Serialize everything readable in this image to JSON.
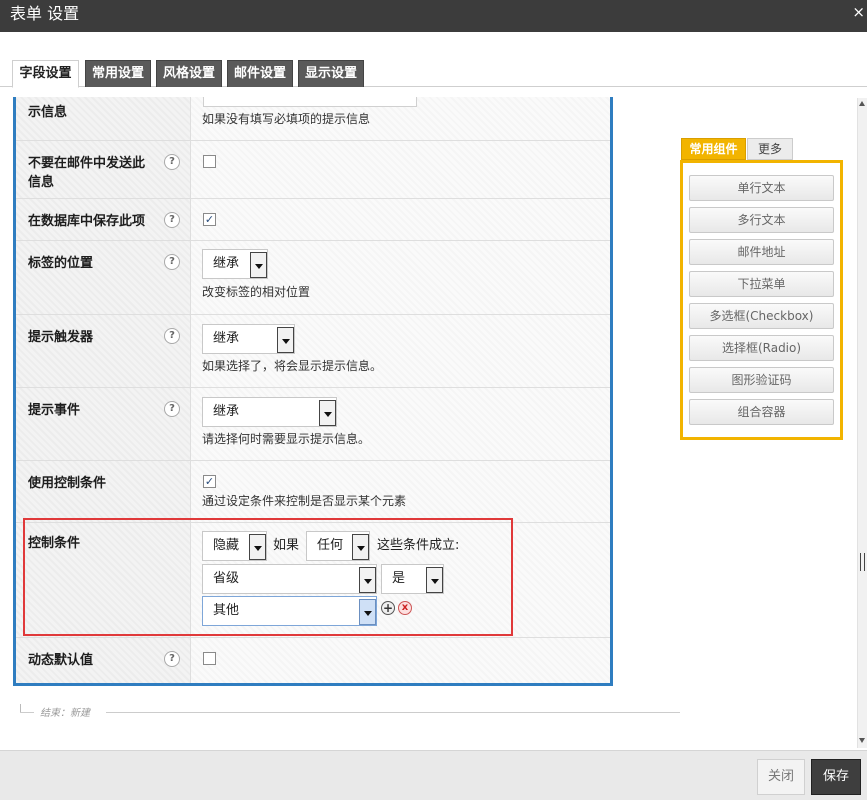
{
  "window": {
    "title": "表单 设置",
    "close_glyph": "×"
  },
  "tabs": [
    {
      "label": "字段设置"
    },
    {
      "label": "常用设置"
    },
    {
      "label": "风格设置"
    },
    {
      "label": "邮件设置"
    },
    {
      "label": "显示设置"
    }
  ],
  "fields": {
    "required_message": {
      "label_visible": "示信息",
      "description": "如果没有填写必填项的提示信息"
    },
    "no_email": {
      "label": "不要在邮件中发送此信息",
      "help": "?",
      "checked": false
    },
    "save_db": {
      "label": "在数据库中保存此项",
      "help": "?",
      "checked": true,
      "check_glyph": "✓"
    },
    "label_position": {
      "label": "标签的位置",
      "help": "?",
      "select_value": "继承",
      "description": "改变标签的相对位置"
    },
    "tooltip_trigger": {
      "label": "提示触发器",
      "help": "?",
      "select_value": "继承",
      "description": "如果选择了，将会显示提示信息。"
    },
    "tooltip_event": {
      "label": "提示事件",
      "help": "?",
      "select_value": "继承",
      "description": "请选择何时需要显示提示信息。"
    },
    "use_conditions": {
      "label": "使用控制条件",
      "checked": true,
      "check_glyph": "✓",
      "description": "通过设定条件来控制是否显示某个元素"
    },
    "conditions": {
      "label": "控制条件",
      "action": "隐藏",
      "if_text": "如果",
      "match": "任何",
      "suffix": "这些条件成立:",
      "field": "省级",
      "operator": "是",
      "value": "其他",
      "add_glyph": "+",
      "remove_glyph": "x"
    },
    "dynamic_default": {
      "label": "动态默认值",
      "help": "?",
      "checked": false
    }
  },
  "end_marker": "结束：新建",
  "components": {
    "tabs": {
      "common": "常用组件",
      "more": "更多"
    },
    "items": [
      "单行文本",
      "多行文本",
      "邮件地址",
      "下拉菜单",
      "多选框(Checkbox)",
      "选择框(Radio)",
      "图形验证码",
      "组合容器"
    ]
  },
  "footer": {
    "close_label": "关闭",
    "save_label": "保存"
  }
}
